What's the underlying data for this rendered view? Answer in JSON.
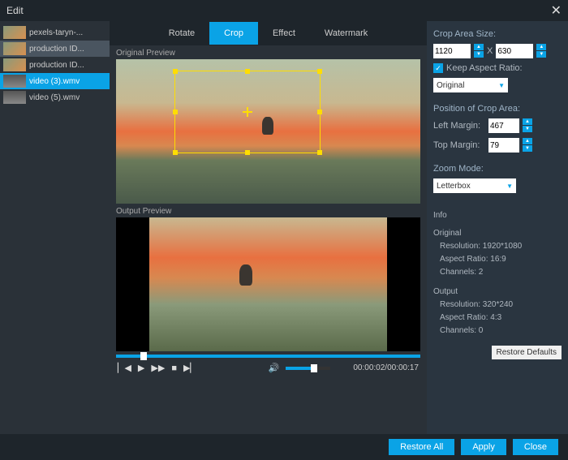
{
  "titlebar": {
    "title": "Edit",
    "close": "✕"
  },
  "sidebar": {
    "items": [
      {
        "label": "pexels-taryn-..."
      },
      {
        "label": "production ID..."
      },
      {
        "label": "production ID..."
      },
      {
        "label": "video (3).wmv"
      },
      {
        "label": "video (5).wmv"
      }
    ]
  },
  "tabs": {
    "rotate": "Rotate",
    "crop": "Crop",
    "effect": "Effect",
    "watermark": "Watermark"
  },
  "preview": {
    "original_label": "Original Preview",
    "output_label": "Output Preview"
  },
  "playback": {
    "time": "00:00:02/00:00:17"
  },
  "panel": {
    "crop_size_label": "Crop Area Size:",
    "width": "1120",
    "x": "X",
    "height": "630",
    "keep_ratio_label": "Keep Aspect Ratio:",
    "ratio_select": "Original",
    "position_label": "Position of Crop Area:",
    "left_margin_label": "Left Margin:",
    "left_margin": "467",
    "top_margin_label": "Top Margin:",
    "top_margin": "79",
    "zoom_label": "Zoom Mode:",
    "zoom_select": "Letterbox",
    "info_label": "Info",
    "original_label": "Original",
    "orig_res": "Resolution: 1920*1080",
    "orig_ratio": "Aspect Ratio: 16:9",
    "orig_channels": "Channels: 2",
    "output_label": "Output",
    "out_res": "Resolution: 320*240",
    "out_ratio": "Aspect Ratio: 4:3",
    "out_channels": "Channels: 0",
    "restore_defaults": "Restore Defaults"
  },
  "bottom": {
    "restore_all": "Restore All",
    "apply": "Apply",
    "close": "Close"
  }
}
